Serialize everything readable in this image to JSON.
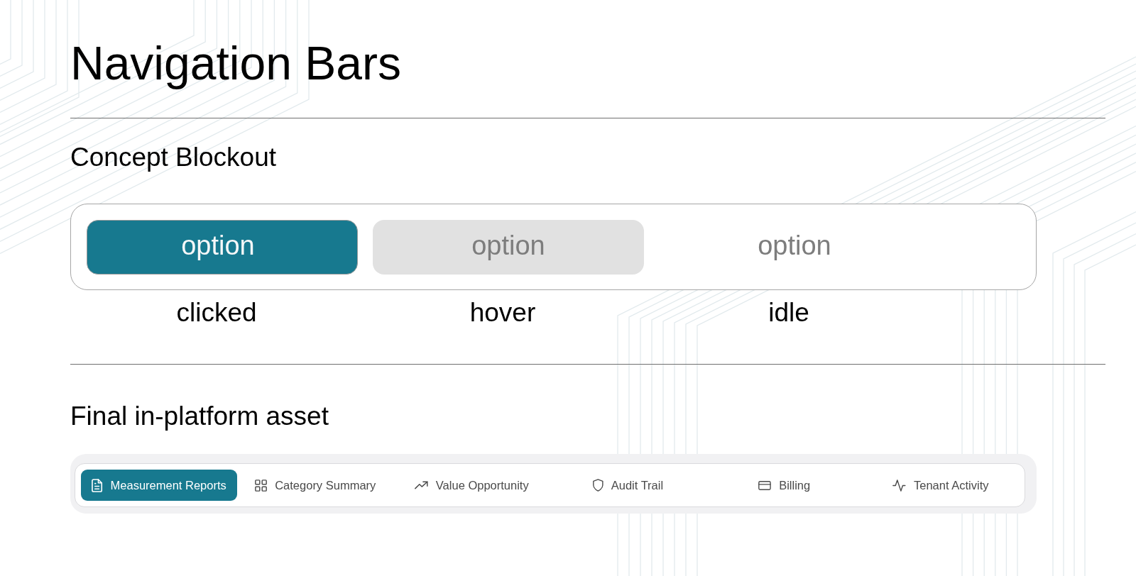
{
  "page": {
    "title": "Navigation Bars"
  },
  "concept_blockout": {
    "heading": "Concept Blockout",
    "options": [
      {
        "label": "option",
        "kind": "clicked",
        "caption": "clicked"
      },
      {
        "label": "option",
        "kind": "hover",
        "caption": "hover"
      },
      {
        "label": "option",
        "kind": "idle",
        "caption": "idle"
      }
    ]
  },
  "final_asset": {
    "heading": "Final in-platform asset",
    "tabs": [
      {
        "label": "Measurement Reports",
        "selected": true
      },
      {
        "label": "Category Summary",
        "selected": false
      },
      {
        "label": "Value Opportunity",
        "selected": false
      },
      {
        "label": "Audit Trail",
        "selected": false
      },
      {
        "label": "Billing",
        "selected": false
      },
      {
        "label": "Tenant Activity",
        "selected": false
      }
    ]
  }
}
